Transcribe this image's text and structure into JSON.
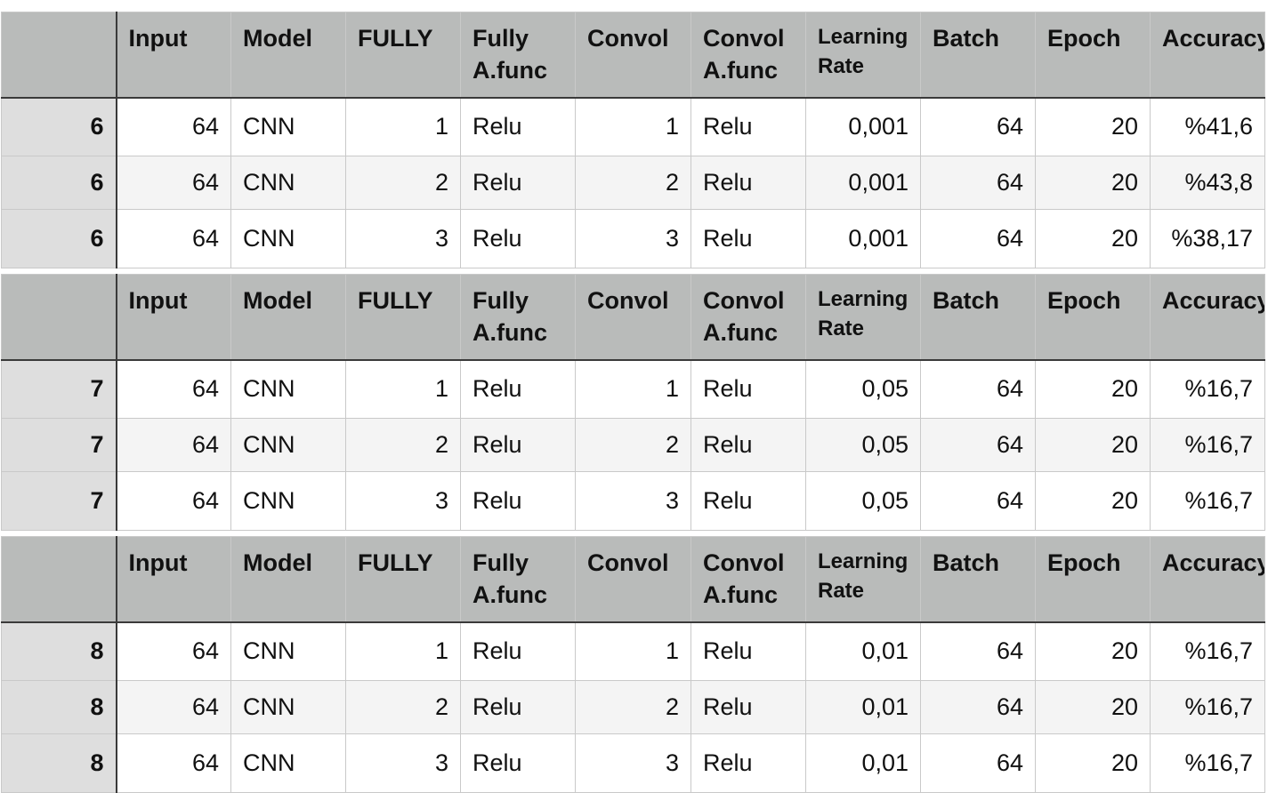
{
  "headers": [
    "",
    "Input",
    "Model",
    "FULLY",
    "Fully A.func",
    "Convol",
    "Convol A.func",
    "Learning Rate",
    "Batch",
    "Epoch",
    "Accuracy"
  ],
  "tables": [
    {
      "rows": [
        {
          "id": "6",
          "input": "64",
          "model": "CNN",
          "fully": "1",
          "fully_afunc": "Relu",
          "convol": "1",
          "convol_afunc": "Relu",
          "learning_rate": "0,001",
          "batch": "64",
          "epoch": "20",
          "accuracy": "%41,6"
        },
        {
          "id": "6",
          "input": "64",
          "model": "CNN",
          "fully": "2",
          "fully_afunc": "Relu",
          "convol": "2",
          "convol_afunc": "Relu",
          "learning_rate": "0,001",
          "batch": "64",
          "epoch": "20",
          "accuracy": "%43,8"
        },
        {
          "id": "6",
          "input": "64",
          "model": "CNN",
          "fully": "3",
          "fully_afunc": "Relu",
          "convol": "3",
          "convol_afunc": "Relu",
          "learning_rate": "0,001",
          "batch": "64",
          "epoch": "20",
          "accuracy": "%38,17"
        }
      ]
    },
    {
      "rows": [
        {
          "id": "7",
          "input": "64",
          "model": "CNN",
          "fully": "1",
          "fully_afunc": "Relu",
          "convol": "1",
          "convol_afunc": "Relu",
          "learning_rate": "0,05",
          "batch": "64",
          "epoch": "20",
          "accuracy": "%16,7"
        },
        {
          "id": "7",
          "input": "64",
          "model": "CNN",
          "fully": "2",
          "fully_afunc": "Relu",
          "convol": "2",
          "convol_afunc": "Relu",
          "learning_rate": "0,05",
          "batch": "64",
          "epoch": "20",
          "accuracy": "%16,7"
        },
        {
          "id": "7",
          "input": "64",
          "model": "CNN",
          "fully": "3",
          "fully_afunc": "Relu",
          "convol": "3",
          "convol_afunc": "Relu",
          "learning_rate": "0,05",
          "batch": "64",
          "epoch": "20",
          "accuracy": "%16,7"
        }
      ]
    },
    {
      "rows": [
        {
          "id": "8",
          "input": "64",
          "model": "CNN",
          "fully": "1",
          "fully_afunc": "Relu",
          "convol": "1",
          "convol_afunc": "Relu",
          "learning_rate": "0,01",
          "batch": "64",
          "epoch": "20",
          "accuracy": "%16,7"
        },
        {
          "id": "8",
          "input": "64",
          "model": "CNN",
          "fully": "2",
          "fully_afunc": "Relu",
          "convol": "2",
          "convol_afunc": "Relu",
          "learning_rate": "0,01",
          "batch": "64",
          "epoch": "20",
          "accuracy": "%16,7"
        },
        {
          "id": "8",
          "input": "64",
          "model": "CNN",
          "fully": "3",
          "fully_afunc": "Relu",
          "convol": "3",
          "convol_afunc": "Relu",
          "learning_rate": "0,01",
          "batch": "64",
          "epoch": "20",
          "accuracy": "%16,7"
        }
      ]
    }
  ],
  "colors": {
    "header_bg": "#b9bbba",
    "row_header_bg": "#dedede",
    "alt_row_bg": "#f4f4f4"
  }
}
